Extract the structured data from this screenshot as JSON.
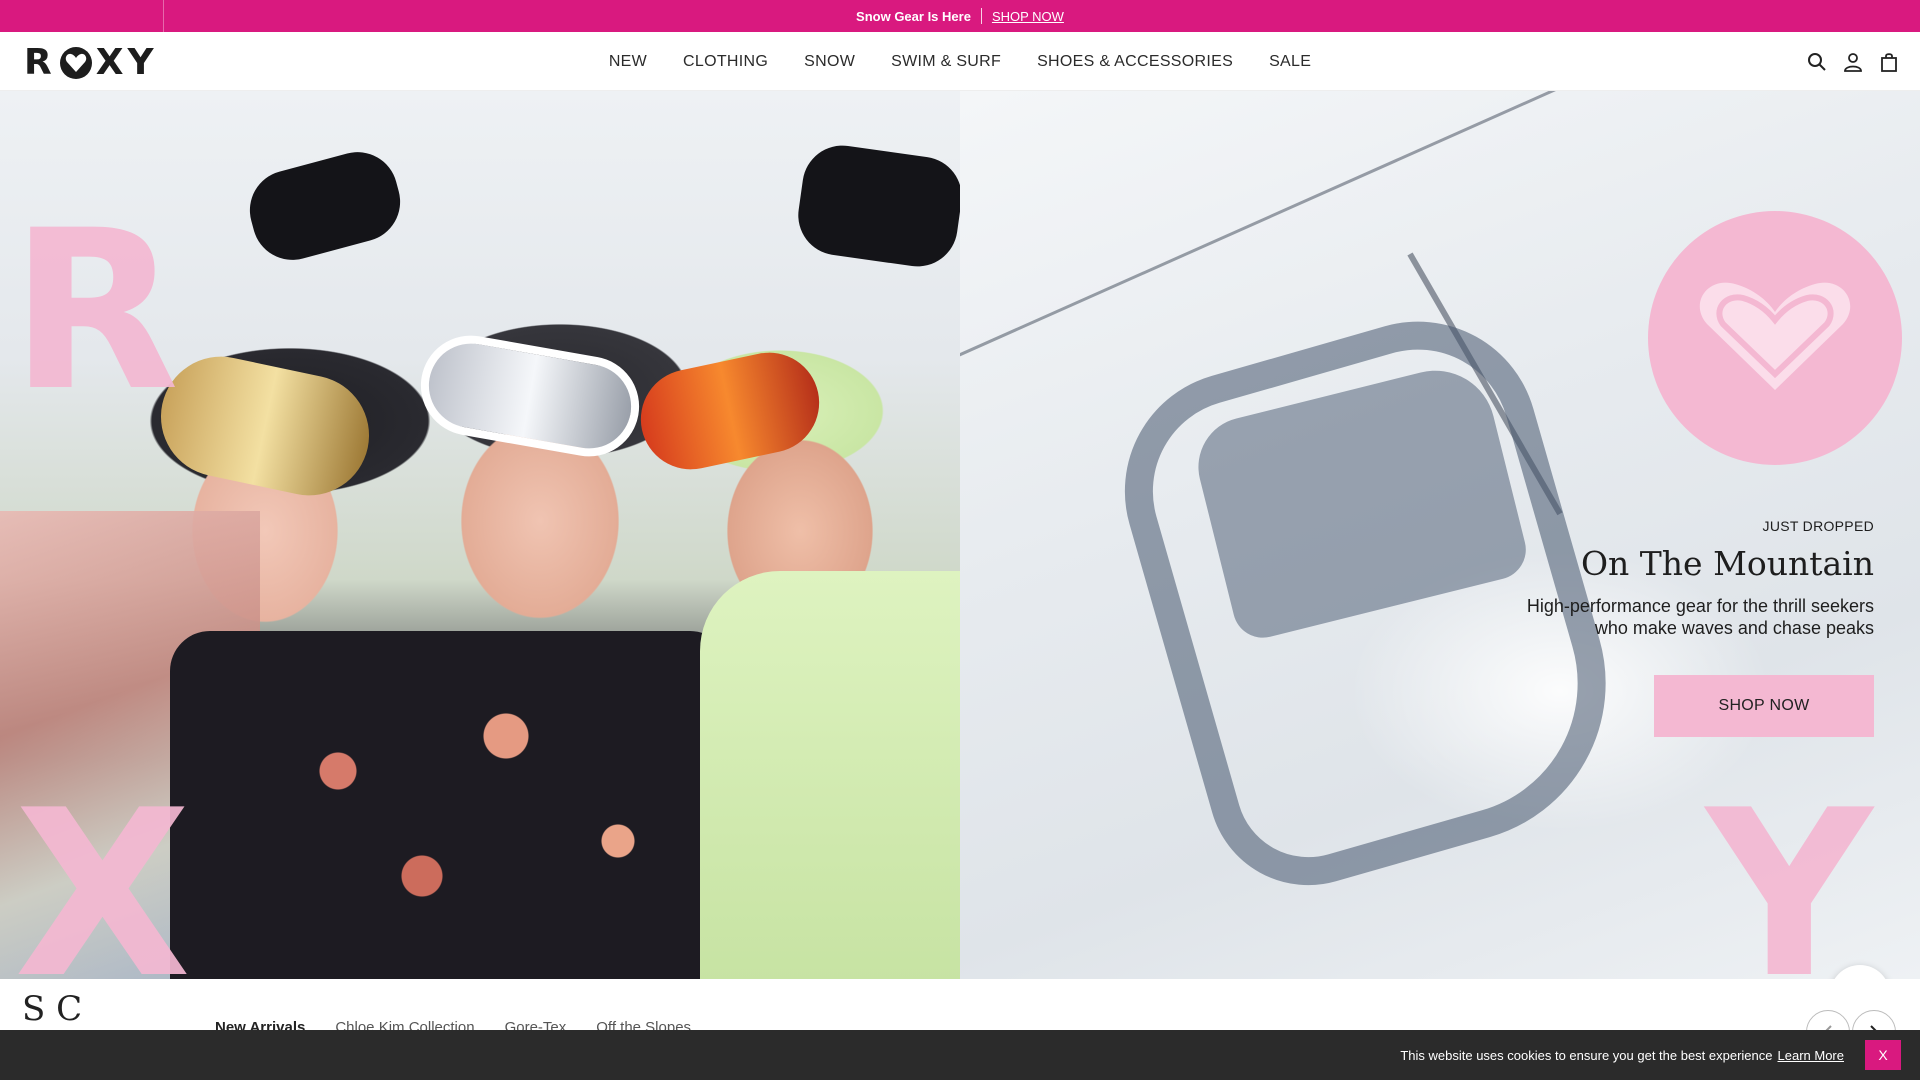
{
  "promo": {
    "text": "Snow Gear Is Here",
    "link_label": "SHOP NOW"
  },
  "header": {
    "logo_text_left": "R",
    "logo_text_right": "XY",
    "nav": [
      {
        "label": "NEW"
      },
      {
        "label": "CLOTHING"
      },
      {
        "label": "SNOW"
      },
      {
        "label": "SWIM & SURF"
      },
      {
        "label": "SHOES & ACCESSORIES"
      },
      {
        "label": "SALE"
      }
    ],
    "icons": [
      "search-icon",
      "account-icon",
      "bag-icon"
    ]
  },
  "hero": {
    "letters": {
      "r": "R",
      "x": "X",
      "y": "Y"
    },
    "eyebrow": "JUST DROPPED",
    "title": "On The Mountain",
    "description": "High-performance gear for the thrill seekers who make waves and chase peaks",
    "cta_label": "SHOP NOW"
  },
  "section": {
    "title": "S C",
    "tabs": [
      {
        "label": "New Arrivals",
        "active": true
      },
      {
        "label": "Chloe Kim Collection",
        "active": false
      },
      {
        "label": "Gore-Tex",
        "active": false
      },
      {
        "label": "Off the Slopes",
        "active": false
      }
    ]
  },
  "cookie": {
    "text": "This website uses cookies to ensure you get the best experience",
    "learn_more": "Learn More",
    "close_label": "X"
  },
  "colors": {
    "brand_pink": "#d9197f",
    "light_pink": "#f4b8d2",
    "cookie_bg": "#2b2b2b"
  }
}
